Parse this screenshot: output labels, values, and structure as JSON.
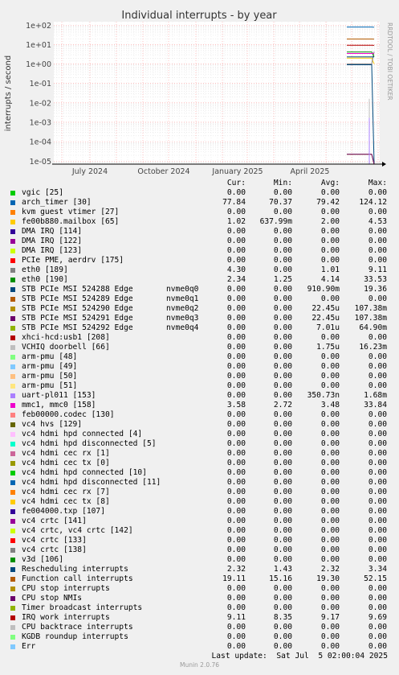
{
  "chart_data": {
    "type": "line",
    "title": "Individual interrupts - by year",
    "ylabel": "interrupts / second",
    "yscale": "log",
    "ylim": [
      7e-06,
      150
    ],
    "y_ticks": [
      "1e+02",
      "1e+01",
      "1e+00",
      "1e-01",
      "1e-02",
      "1e-03",
      "1e-04",
      "1e-05"
    ],
    "x_ticks": [
      "July 2024",
      "October 2024",
      "January 2025",
      "April 2025"
    ],
    "grid": true,
    "series": [
      {
        "name": "vgic [25]",
        "color": "#00cc00",
        "cur": "0.00",
        "min": "0.00",
        "avg": "0.00",
        "max": "0.00"
      },
      {
        "name": "arch_timer [30]",
        "color": "#0066b3",
        "cur": "77.84",
        "min": "70.37",
        "avg": "79.42",
        "max": "124.12"
      },
      {
        "name": "kvm guest vtimer [27]",
        "color": "#ff8000",
        "cur": "0.00",
        "min": "0.00",
        "avg": "0.00",
        "max": "0.00"
      },
      {
        "name": "fe00b880.mailbox [65]",
        "color": "#ffcc00",
        "cur": "1.02",
        "min": "637.99m",
        "avg": "2.00",
        "max": "4.53"
      },
      {
        "name": "DMA IRQ [114]",
        "color": "#330099",
        "cur": "0.00",
        "min": "0.00",
        "avg": "0.00",
        "max": "0.00"
      },
      {
        "name": "DMA IRQ [122]",
        "color": "#990099",
        "cur": "0.00",
        "min": "0.00",
        "avg": "0.00",
        "max": "0.00"
      },
      {
        "name": "DMA IRQ [123]",
        "color": "#ccff00",
        "cur": "0.00",
        "min": "0.00",
        "avg": "0.00",
        "max": "0.00"
      },
      {
        "name": "PCIe PME, aerdrv [175]",
        "color": "#ff0000",
        "cur": "0.00",
        "min": "0.00",
        "avg": "0.00",
        "max": "0.00"
      },
      {
        "name": "eth0 [189]",
        "color": "#808080",
        "cur": "4.30",
        "min": "0.00",
        "avg": "1.01",
        "max": "9.11"
      },
      {
        "name": "eth0 [190]",
        "color": "#008f00",
        "cur": "2.34",
        "min": "1.25",
        "avg": "4.14",
        "max": "33.53"
      },
      {
        "name": "STB PCIe MSI 524288 Edge",
        "dev": "nvme0q0",
        "color": "#00487d",
        "cur": "0.00",
        "min": "0.00",
        "avg": "910.90m",
        "max": "19.36"
      },
      {
        "name": "STB PCIe MSI 524289 Edge",
        "dev": "nvme0q1",
        "color": "#b35a00",
        "cur": "0.00",
        "min": "0.00",
        "avg": "0.00",
        "max": "0.00"
      },
      {
        "name": "STB PCIe MSI 524290 Edge",
        "dev": "nvme0q2",
        "color": "#b38f00",
        "cur": "0.00",
        "min": "0.00",
        "avg": "22.45u",
        "max": "107.38m"
      },
      {
        "name": "STB PCIe MSI 524291 Edge",
        "dev": "nvme0q3",
        "color": "#6b006b",
        "cur": "0.00",
        "min": "0.00",
        "avg": "22.45u",
        "max": "107.38m"
      },
      {
        "name": "STB PCIe MSI 524292 Edge",
        "dev": "nvme0q4",
        "color": "#8fb300",
        "cur": "0.00",
        "min": "0.00",
        "avg": "7.01u",
        "max": "64.90m"
      },
      {
        "name": "xhci-hcd:usb1 [208]",
        "color": "#b30000",
        "cur": "0.00",
        "min": "0.00",
        "avg": "0.00",
        "max": "0.00"
      },
      {
        "name": "VCHIQ doorbell [66]",
        "color": "#bebebe",
        "cur": "0.00",
        "min": "0.00",
        "avg": "1.75u",
        "max": "16.23m"
      },
      {
        "name": "arm-pmu [48]",
        "color": "#80ff80",
        "cur": "0.00",
        "min": "0.00",
        "avg": "0.00",
        "max": "0.00"
      },
      {
        "name": "arm-pmu [49]",
        "color": "#80c9ff",
        "cur": "0.00",
        "min": "0.00",
        "avg": "0.00",
        "max": "0.00"
      },
      {
        "name": "arm-pmu [50]",
        "color": "#ffc080",
        "cur": "0.00",
        "min": "0.00",
        "avg": "0.00",
        "max": "0.00"
      },
      {
        "name": "arm-pmu [51]",
        "color": "#ffe680",
        "cur": "0.00",
        "min": "0.00",
        "avg": "0.00",
        "max": "0.00"
      },
      {
        "name": "uart-pl011 [153]",
        "color": "#aa80ff",
        "cur": "0.00",
        "min": "0.00",
        "avg": "350.73n",
        "max": "1.68m"
      },
      {
        "name": "mmc1, mmc0 [158]",
        "color": "#ee00cc",
        "cur": "3.58",
        "min": "2.72",
        "avg": "3.48",
        "max": "33.84"
      },
      {
        "name": "feb00000.codec [130]",
        "color": "#ff8080",
        "cur": "0.00",
        "min": "0.00",
        "avg": "0.00",
        "max": "0.00"
      },
      {
        "name": "vc4 hvs [129]",
        "color": "#666600",
        "cur": "0.00",
        "min": "0.00",
        "avg": "0.00",
        "max": "0.00"
      },
      {
        "name": "vc4 hdmi hpd connected [4]",
        "color": "#ffbfff",
        "cur": "0.00",
        "min": "0.00",
        "avg": "0.00",
        "max": "0.00"
      },
      {
        "name": "vc4 hdmi hpd disconnected [5]",
        "color": "#00ffcc",
        "cur": "0.00",
        "min": "0.00",
        "avg": "0.00",
        "max": "0.00"
      },
      {
        "name": "vc4 hdmi cec rx [1]",
        "color": "#cc6699",
        "cur": "0.00",
        "min": "0.00",
        "avg": "0.00",
        "max": "0.00"
      },
      {
        "name": "vc4 hdmi cec tx [0]",
        "color": "#999900",
        "cur": "0.00",
        "min": "0.00",
        "avg": "0.00",
        "max": "0.00"
      },
      {
        "name": "vc4 hdmi hpd connected [10]",
        "color": "#00cc00",
        "cur": "0.00",
        "min": "0.00",
        "avg": "0.00",
        "max": "0.00"
      },
      {
        "name": "vc4 hdmi hpd disconnected [11]",
        "color": "#0066b3",
        "cur": "0.00",
        "min": "0.00",
        "avg": "0.00",
        "max": "0.00"
      },
      {
        "name": "vc4 hdmi cec rx [7]",
        "color": "#ff8000",
        "cur": "0.00",
        "min": "0.00",
        "avg": "0.00",
        "max": "0.00"
      },
      {
        "name": "vc4 hdmi cec tx [8]",
        "color": "#ffcc00",
        "cur": "0.00",
        "min": "0.00",
        "avg": "0.00",
        "max": "0.00"
      },
      {
        "name": "fe004000.txp [107]",
        "color": "#330099",
        "cur": "0.00",
        "min": "0.00",
        "avg": "0.00",
        "max": "0.00"
      },
      {
        "name": "vc4 crtc [141]",
        "color": "#990099",
        "cur": "0.00",
        "min": "0.00",
        "avg": "0.00",
        "max": "0.00"
      },
      {
        "name": "vc4 crtc, vc4 crtc [142]",
        "color": "#ccff00",
        "cur": "0.00",
        "min": "0.00",
        "avg": "0.00",
        "max": "0.00"
      },
      {
        "name": "vc4 crtc [133]",
        "color": "#ff0000",
        "cur": "0.00",
        "min": "0.00",
        "avg": "0.00",
        "max": "0.00"
      },
      {
        "name": "vc4 crtc [138]",
        "color": "#808080",
        "cur": "0.00",
        "min": "0.00",
        "avg": "0.00",
        "max": "0.00"
      },
      {
        "name": "v3d [106]",
        "color": "#008f00",
        "cur": "0.00",
        "min": "0.00",
        "avg": "0.00",
        "max": "0.00"
      },
      {
        "name": "Rescheduling interrupts",
        "color": "#00487d",
        "cur": "2.32",
        "min": "1.43",
        "avg": "2.32",
        "max": "3.34"
      },
      {
        "name": "Function call interrupts",
        "color": "#b35a00",
        "cur": "19.11",
        "min": "15.16",
        "avg": "19.30",
        "max": "52.15"
      },
      {
        "name": "CPU stop interrupts",
        "color": "#b38f00",
        "cur": "0.00",
        "min": "0.00",
        "avg": "0.00",
        "max": "0.00"
      },
      {
        "name": "CPU stop NMIs",
        "color": "#6b006b",
        "cur": "0.00",
        "min": "0.00",
        "avg": "0.00",
        "max": "0.00"
      },
      {
        "name": "Timer broadcast interrupts",
        "color": "#8fb300",
        "cur": "0.00",
        "min": "0.00",
        "avg": "0.00",
        "max": "0.00"
      },
      {
        "name": "IRQ work interrupts",
        "color": "#b30000",
        "cur": "9.11",
        "min": "8.35",
        "avg": "9.17",
        "max": "9.69"
      },
      {
        "name": "CPU backtrace interrupts",
        "color": "#bebebe",
        "cur": "0.00",
        "min": "0.00",
        "avg": "0.00",
        "max": "0.00"
      },
      {
        "name": "KGDB roundup interrupts",
        "color": "#80ff80",
        "cur": "0.00",
        "min": "0.00",
        "avg": "0.00",
        "max": "0.00"
      },
      {
        "name": "Err",
        "color": "#80c9ff",
        "cur": "0.00",
        "min": "0.00",
        "avg": "0.00",
        "max": "0.00"
      }
    ]
  },
  "legend_headers": {
    "cur": "Cur:",
    "min": "Min:",
    "avg": "Avg:",
    "max": "Max:"
  },
  "last_update": "Last update:  Sat Jul  5 02:00:04 2025",
  "side_text": "RRDTOOL / TOBI OETIKER",
  "footer": "Munin 2.0.76"
}
